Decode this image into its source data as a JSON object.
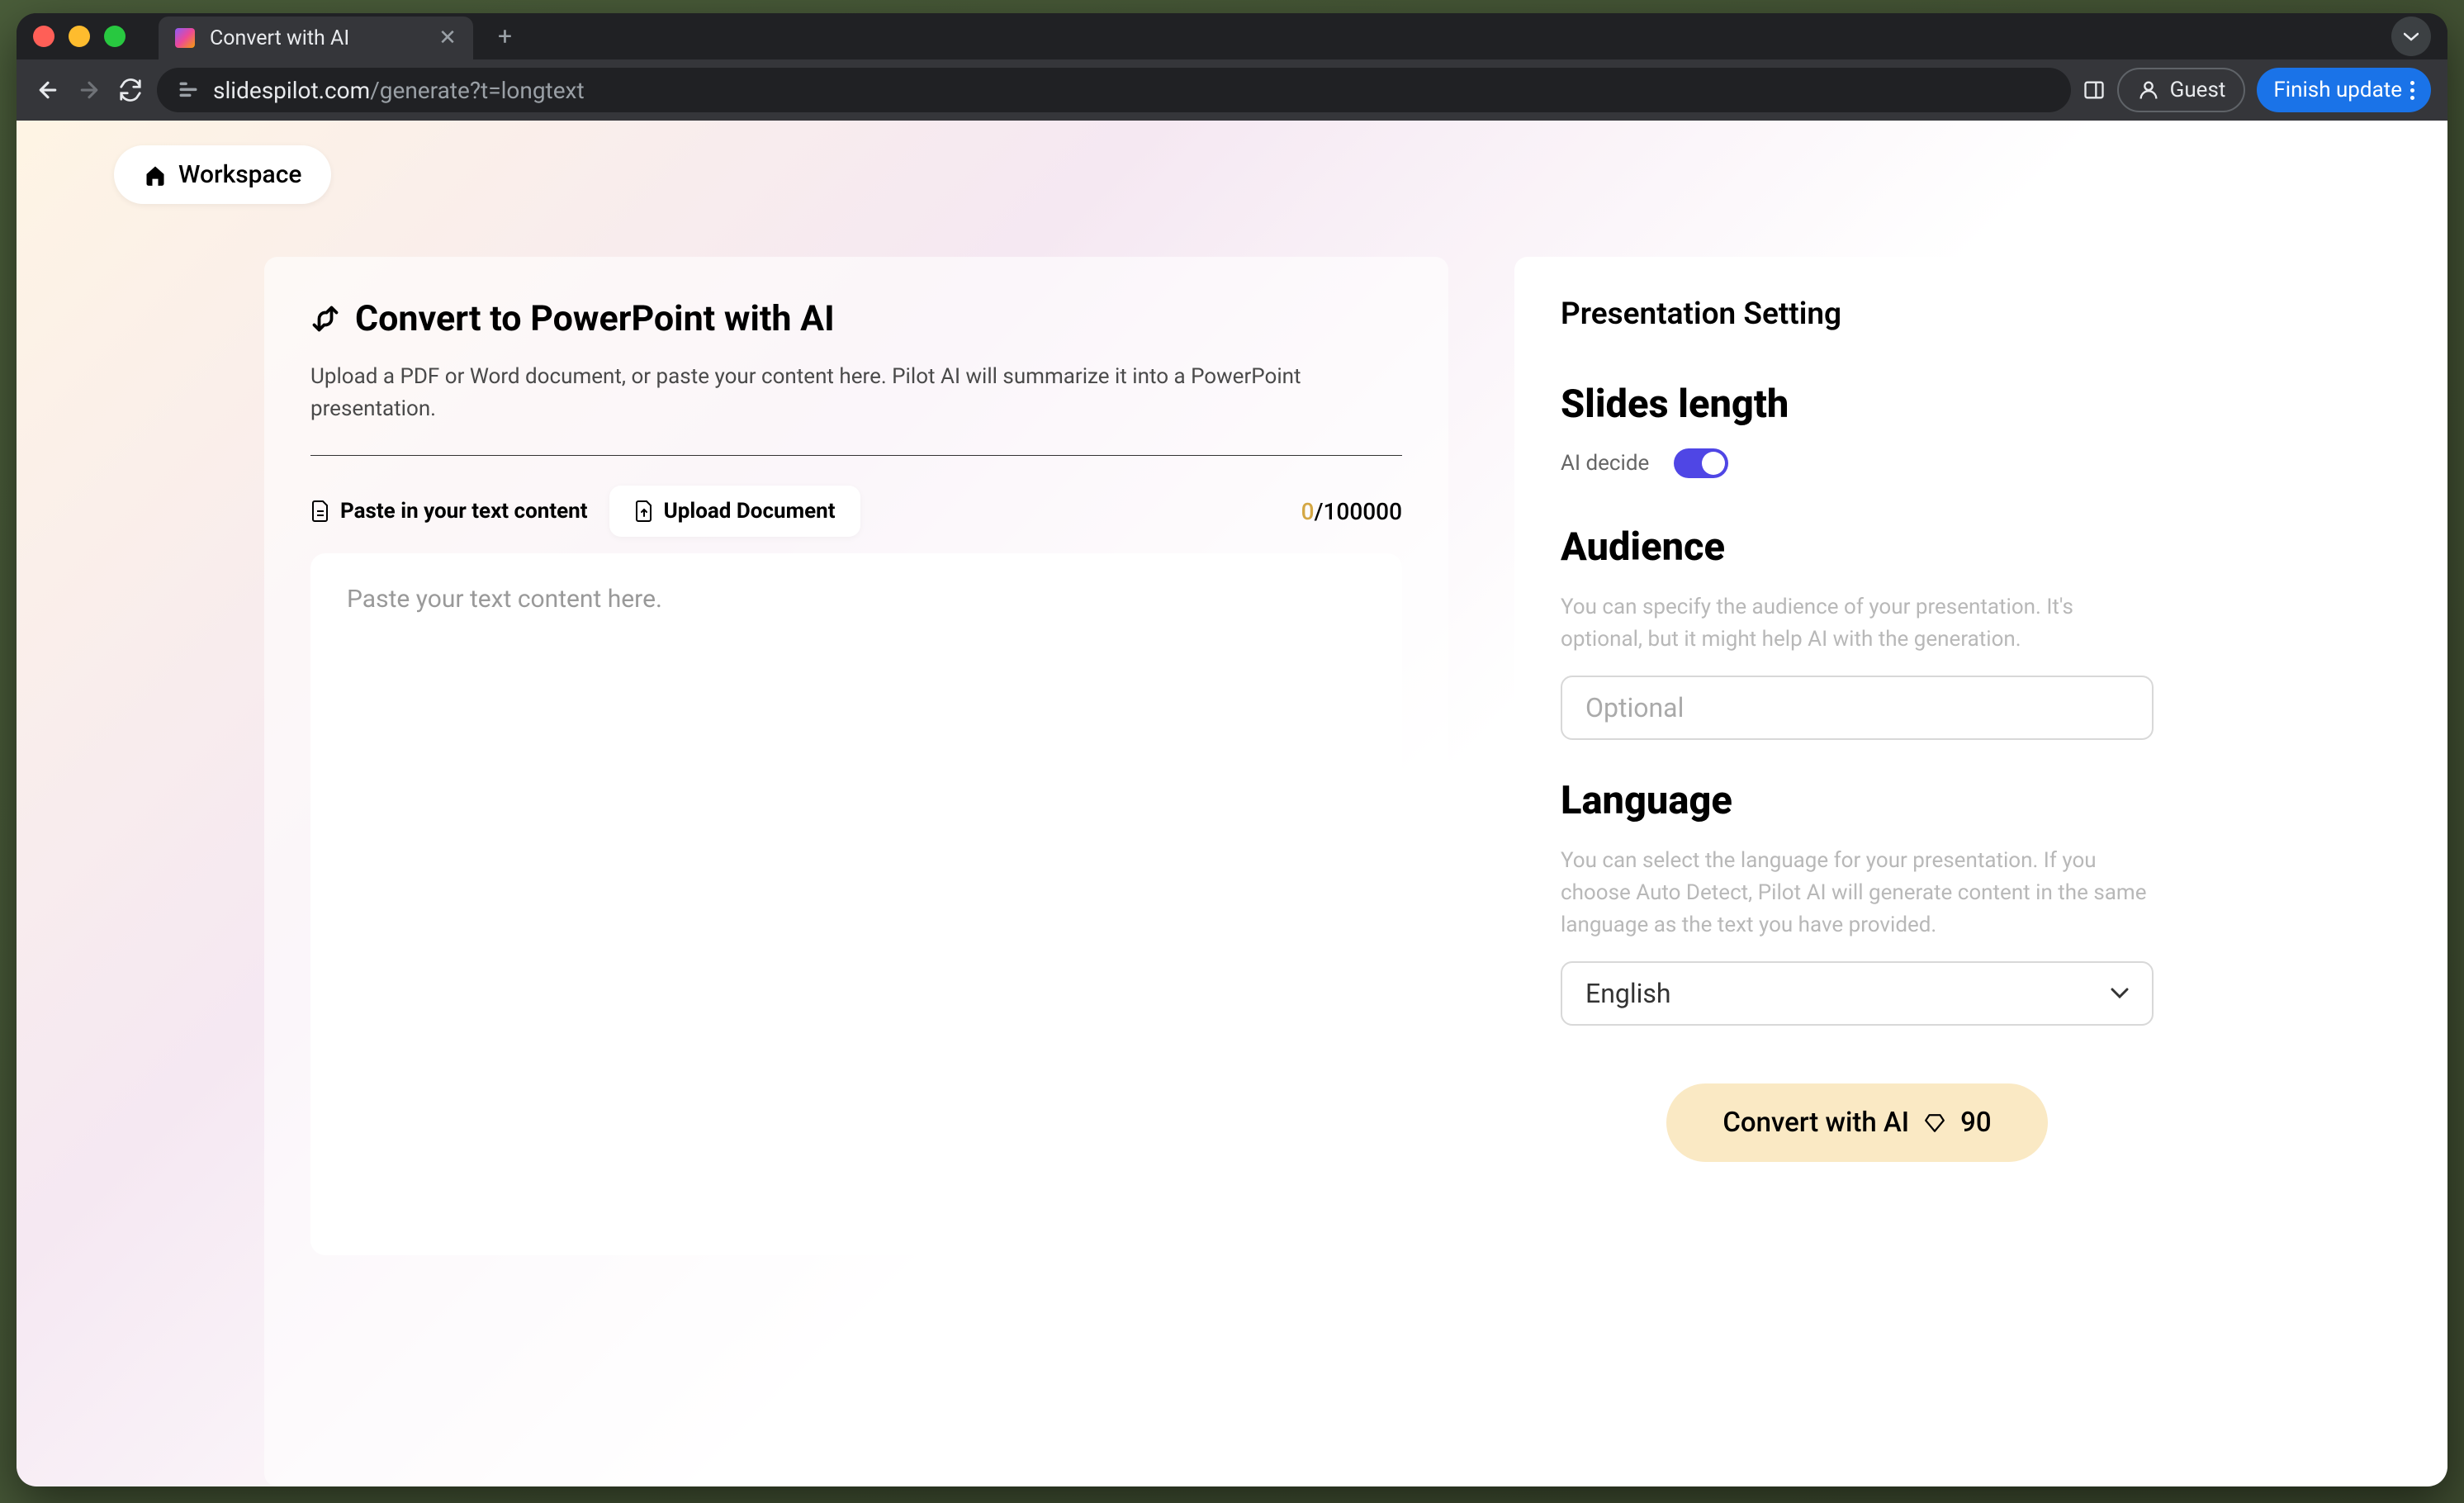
{
  "browser": {
    "tab_title": "Convert with AI",
    "url_domain": "slidespilot.com",
    "url_path": "/generate?t=longtext",
    "guest_label": "Guest",
    "finish_update_label": "Finish update"
  },
  "workspace_label": "Workspace",
  "main": {
    "title": "Convert to PowerPoint with AI",
    "subtitle": "Upload a PDF or Word document, or paste your content here. Pilot AI will summarize it into a PowerPoint presentation.",
    "paste_tab": "Paste in your text content",
    "upload_tab": "Upload Document",
    "char_current": "0",
    "char_max": "/100000",
    "textarea_placeholder": "Paste your text content here."
  },
  "settings": {
    "heading": "Presentation Setting",
    "slides_length": {
      "title": "Slides length",
      "toggle_label": "AI decide",
      "toggle_on": true
    },
    "audience": {
      "title": "Audience",
      "desc": "You can specify the audience of your presentation. It's optional, but it might help AI with the generation.",
      "placeholder": "Optional"
    },
    "language": {
      "title": "Language",
      "desc": "You can select the language for your presentation. If you choose Auto Detect, Pilot AI will generate content in the same language as the text you have provided.",
      "selected": "English"
    },
    "convert_button": "Convert with AI",
    "credits": "90"
  }
}
